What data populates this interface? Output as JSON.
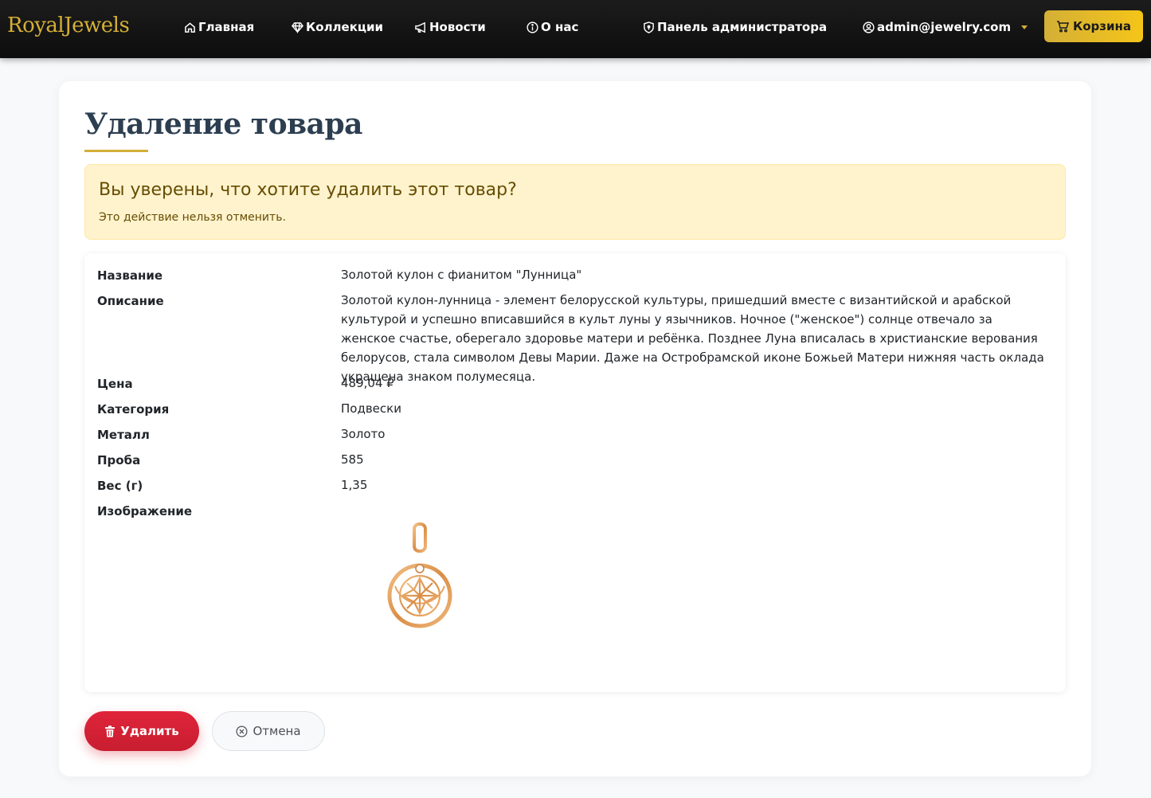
{
  "brand": "RoyalJewels",
  "nav": {
    "home": "Главная",
    "collections": "Коллекции",
    "news": "Новости",
    "about": "О нас",
    "admin_panel": "Панель администратора",
    "user": "admin@jewelry.com",
    "cart": "Корзина"
  },
  "page": {
    "title": "Удаление товара"
  },
  "alert": {
    "heading": "Вы уверены, что хотите удалить этот товар?",
    "text": "Это действие нельзя отменить."
  },
  "product": {
    "name_label": "Название",
    "name": "Золотой кулон с фианитом \"Лунница\"",
    "description_label": "Описание",
    "description": "Золотой кулон-лунница - элемент белорусской культуры, пришедший вместе с византийской и арабской культурой и успешно вписавшийся в культ луны у язычников. Ночное (\"женское\") солнце отвечало за женское счастье, оберегало здоровье матери и ребёнка. Позднее Луна вписалась в христианские верования белорусов, стала символом Девы Марии. Даже на Остробрамской иконе Божьей Матери нижняя часть оклада украшена знаком полумесяца.",
    "price_label": "Цена",
    "price": "489,04 ₽",
    "category_label": "Категория",
    "category": "Подвески",
    "metal_label": "Металл",
    "metal": "Золото",
    "purity_label": "Проба",
    "purity": "585",
    "weight_label": "Вес (г)",
    "weight": "1,35",
    "image_label": "Изображение"
  },
  "actions": {
    "delete": "Удалить",
    "cancel": "Отмена"
  },
  "colors": {
    "gold": "#d4af37",
    "danger": "#dc3545",
    "warning_bg": "#fff3cd",
    "navbar_bg": "#111111"
  }
}
